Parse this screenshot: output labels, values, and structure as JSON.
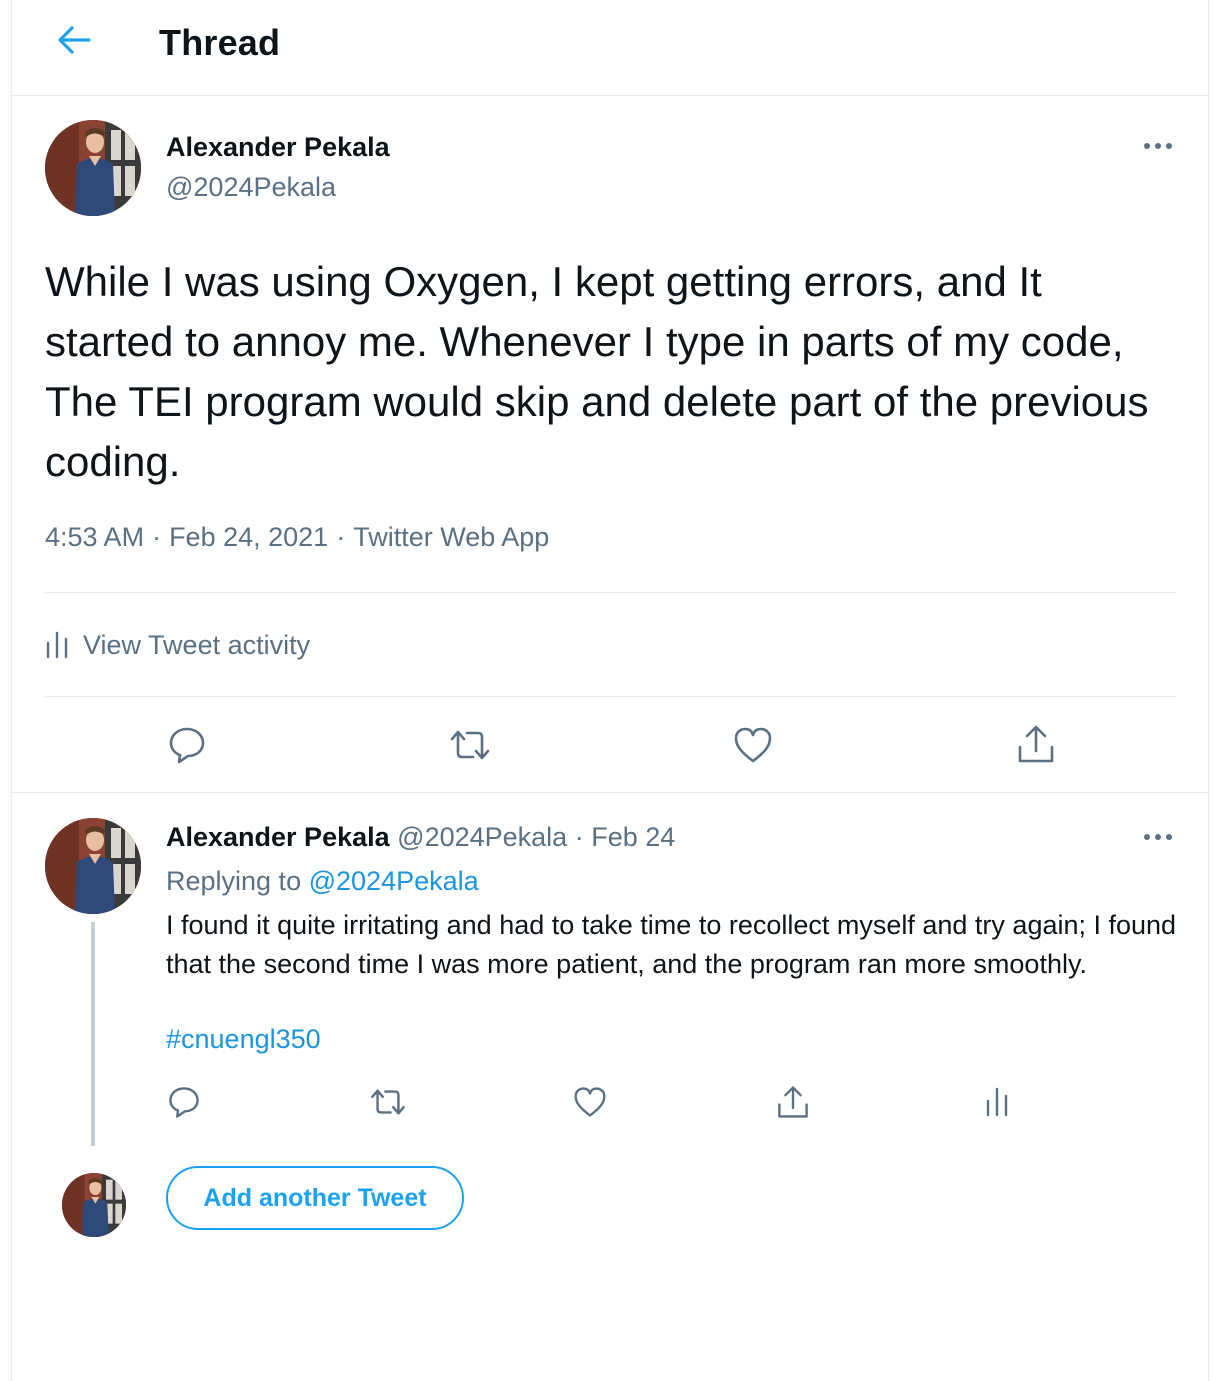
{
  "header": {
    "title": "Thread"
  },
  "main_tweet": {
    "author_name": "Alexander Pekala",
    "author_handle": "@2024Pekala",
    "text": "While I was using Oxygen, I kept getting errors, and It started to annoy me. Whenever I type in parts of my code, The TEI program would skip and delete part of the previous coding.",
    "time": "4:53 AM",
    "date": "Feb 24, 2021",
    "source": "Twitter Web App",
    "separator": "·",
    "activity_label": "View Tweet activity"
  },
  "reply_tweet": {
    "author_name": "Alexander Pekala",
    "author_handle": "@2024Pekala",
    "dot": "·",
    "date": "Feb 24",
    "replying_prefix": "Replying to",
    "replying_to": "@2024Pekala",
    "text": "I found it quite irritating and had to take time to recollect myself and try again; I found that the second time I was more patient, and the program ran more smoothly.",
    "hashtag": "#cnuengl350"
  },
  "compose": {
    "add_button_label": "Add another Tweet"
  },
  "colors": {
    "accent": "#1da1f2",
    "link": "#1b95e0",
    "secondary_text": "#5b7083",
    "border": "#e6ecf0"
  },
  "icons": {
    "back": "arrow-left-icon",
    "more": "more-horizontal-icon",
    "reply": "comment-bubble-icon",
    "retweet": "retweet-icon",
    "like": "heart-icon",
    "share": "share-upload-icon",
    "analytics": "bar-chart-icon"
  }
}
